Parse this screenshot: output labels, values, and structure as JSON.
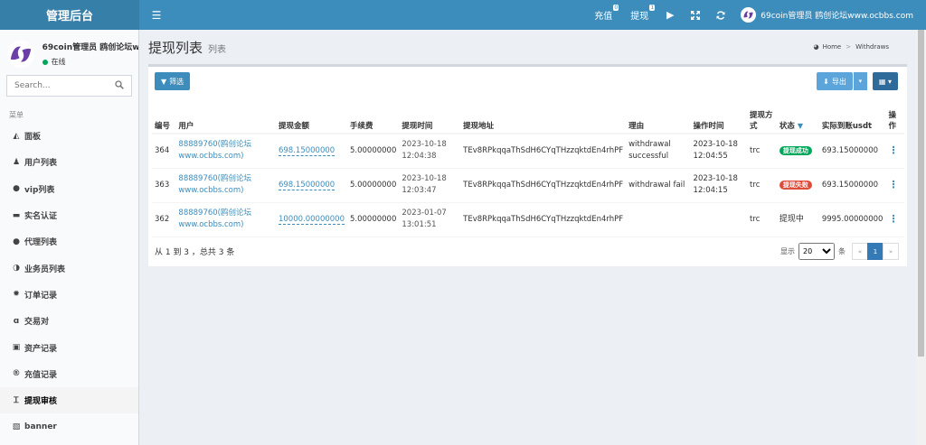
{
  "header": {
    "logo": "管理后台",
    "recharge": {
      "label": "充值",
      "count": "0"
    },
    "withdraw": {
      "label": "提现",
      "count": "1"
    },
    "user": "69coin管理员 鸥创论坛www.ocbbs.com"
  },
  "sidebar": {
    "user_name": "69coin管理员 鸥创论坛www",
    "status": "在线",
    "search_placeholder": "Search...",
    "menu_header": "菜单",
    "items": [
      {
        "label": "面板",
        "icon": "area-chart-icon"
      },
      {
        "label": "用户列表",
        "icon": "user-icon"
      },
      {
        "label": "vip列表",
        "icon": "chevron-circle-icon"
      },
      {
        "label": "实名认证",
        "icon": "id-card-icon"
      },
      {
        "label": "代理列表",
        "icon": "circle-up-icon"
      },
      {
        "label": "业务员列表",
        "icon": "half-circle-icon"
      },
      {
        "label": "订单记录",
        "icon": "gear-icon"
      },
      {
        "label": "交易对",
        "icon": "amazon-a-icon"
      },
      {
        "label": "资产记录",
        "icon": "money-icon"
      },
      {
        "label": "充值记录",
        "icon": "registered-icon"
      },
      {
        "label": "提现审核",
        "icon": "text-icon"
      },
      {
        "label": "banner",
        "icon": "image-icon"
      }
    ]
  },
  "page": {
    "title": "提现列表",
    "subtitle": "列表",
    "breadcrumb_home": "Home",
    "breadcrumb_current": "Withdraws"
  },
  "toolbar": {
    "filter_label": "筛选",
    "export_label": "导出"
  },
  "table": {
    "headers": {
      "id": "编号",
      "user": "用户",
      "amount": "提现金额",
      "fee": "手续费",
      "time": "提现时间",
      "address": "提现地址",
      "reason": "理由",
      "op_time": "操作时间",
      "method": "提现方式",
      "status": "状态",
      "actual": "实际到账usdt",
      "action": "操作"
    },
    "rows": [
      {
        "id": "364",
        "user": "88889760(鸥创论坛www.ocbbs.com)",
        "amount": "698.15000000",
        "fee": "5.00000000",
        "time": "2023-10-18 12:04:38",
        "address": "TEv8RPkqqaThSdH6CYqTHzzqktdEn4rhPF",
        "reason": "withdrawal successful",
        "op_time": "2023-10-18 12:04:55",
        "method": "trc",
        "status": "提现成功",
        "status_type": "ok",
        "actual": "693.15000000"
      },
      {
        "id": "363",
        "user": "88889760(鸥创论坛www.ocbbs.com)",
        "amount": "698.15000000",
        "fee": "5.00000000",
        "time": "2023-10-18 12:03:47",
        "address": "TEv8RPkqqaThSdH6CYqTHzzqktdEn4rhPF",
        "reason": "withdrawal fail",
        "op_time": "2023-10-18 12:04:15",
        "method": "trc",
        "status": "提现失败",
        "status_type": "fail",
        "actual": "693.15000000"
      },
      {
        "id": "362",
        "user": "88889760(鸥创论坛www.ocbbs.com)",
        "amount": "10000.00000000",
        "fee": "5.00000000",
        "time": "2023-01-07 13:01:51",
        "address": "TEv8RPkqqaThSdH6CYqTHzzqktdEn4rhPF",
        "reason": "",
        "op_time": "",
        "method": "trc",
        "status": "提现中",
        "status_type": "plain",
        "actual": "9995.00000000"
      }
    ]
  },
  "footer": {
    "summary": "从 1 到 3 ，总共 3 条",
    "show_label": "显示",
    "page_size": "20",
    "unit": "条",
    "prev": "«",
    "current_page": "1",
    "next": "»"
  },
  "colors": {
    "primary": "#3c8dbc",
    "success": "#00a65a",
    "danger": "#dd4b39"
  }
}
